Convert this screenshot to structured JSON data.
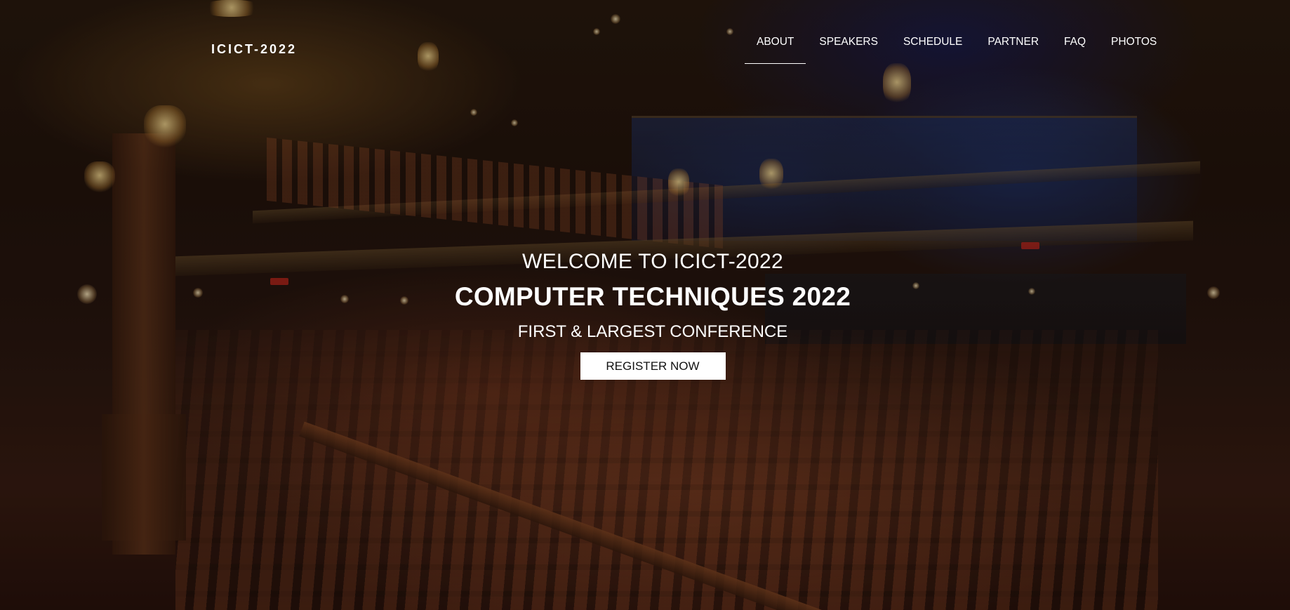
{
  "header": {
    "logo": "ICICT-2022",
    "nav": [
      {
        "label": "ABOUT",
        "active": true
      },
      {
        "label": "SPEAKERS",
        "active": false
      },
      {
        "label": "SCHEDULE",
        "active": false
      },
      {
        "label": "PARTNER",
        "active": false
      },
      {
        "label": "FAQ",
        "active": false
      },
      {
        "label": "PHOTOS",
        "active": false
      }
    ]
  },
  "hero": {
    "welcome": "WELCOME TO ICICT-2022",
    "title": "COMPUTER TECHNIQUES 2022",
    "tagline": "FIRST & LARGEST CONFERENCE",
    "register_label": "REGISTER NOW",
    "background_image": "theater-auditorium-photo"
  },
  "colors": {
    "text": "#ffffff",
    "button_bg": "#ffffff",
    "button_text": "#111111"
  }
}
